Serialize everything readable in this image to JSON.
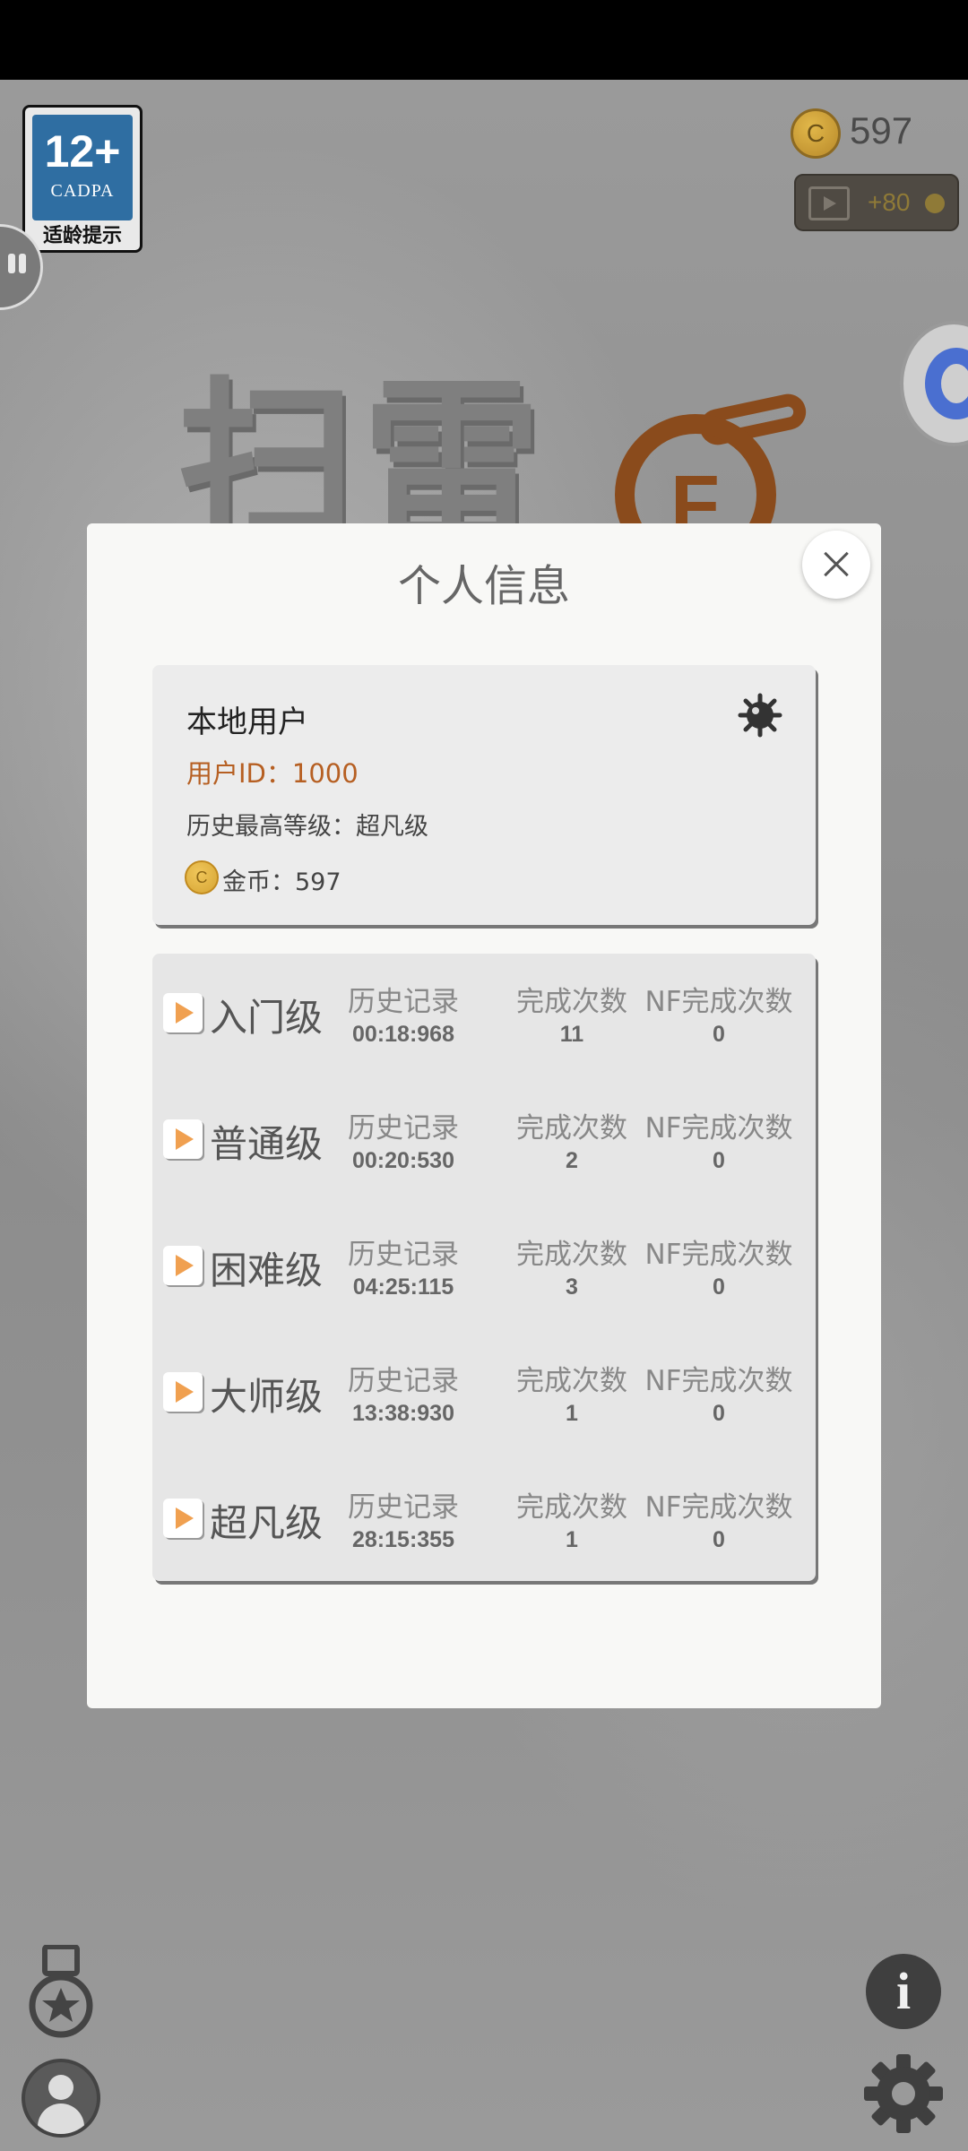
{
  "age_badge": {
    "rating": "12+",
    "org": "CADPA",
    "tip": "适龄提示"
  },
  "hud": {
    "coins": "597",
    "video_reward": "+80",
    "coin_symbol": "C"
  },
  "title_art": {
    "text": "扫雷",
    "logo_letter": "F"
  },
  "dialog": {
    "title": "个人信息",
    "user": {
      "name": "本地用户",
      "id_line": "用户ID：1000",
      "best_level_line": "历史最高等级：超凡级",
      "coin_line": "金币：597",
      "coin_symbol": "C"
    },
    "records": [
      {
        "level": "入门级",
        "best_label": "历史记录",
        "best": "00:18:968",
        "count_label": "完成次数",
        "count": "11",
        "nf_label": "NF完成次数",
        "nf": "0"
      },
      {
        "level": "普通级",
        "best_label": "历史记录",
        "best": "00:20:530",
        "count_label": "完成次数",
        "count": "2",
        "nf_label": "NF完成次数",
        "nf": "0"
      },
      {
        "level": "困难级",
        "best_label": "历史记录",
        "best": "04:25:115",
        "count_label": "完成次数",
        "count": "3",
        "nf_label": "NF完成次数",
        "nf": "0"
      },
      {
        "level": "大师级",
        "best_label": "历史记录",
        "best": "13:38:930",
        "count_label": "完成次数",
        "count": "1",
        "nf_label": "NF完成次数",
        "nf": "0"
      },
      {
        "level": "超凡级",
        "best_label": "历史记录",
        "best": "28:15:355",
        "count_label": "完成次数",
        "count": "1",
        "nf_label": "NF完成次数",
        "nf": "0"
      }
    ]
  },
  "icons": {
    "medal": "medal-icon",
    "avatar": "avatar-icon",
    "info": "i",
    "settings": "gear-icon"
  },
  "colors": {
    "accent_orange": "#b65f22",
    "play_orange": "#f0a050",
    "dialog_bg": "#f8f8f6"
  }
}
